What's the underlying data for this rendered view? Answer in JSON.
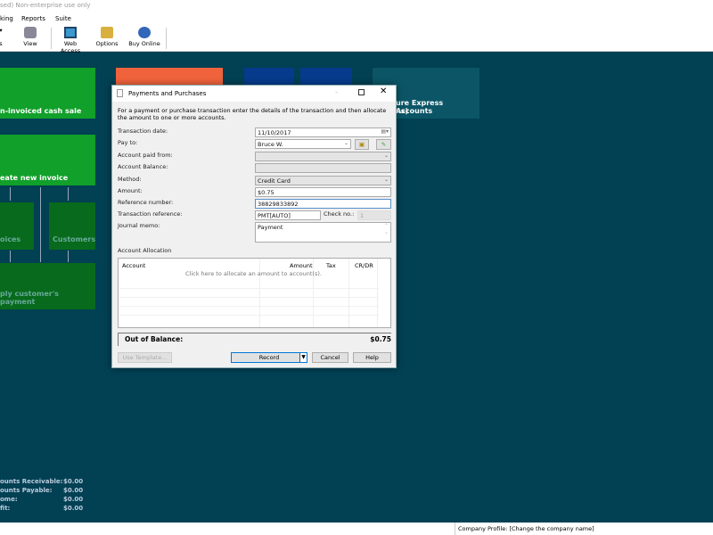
{
  "app": {
    "title": "sed) Non-enterprise use only"
  },
  "menu": [
    "king",
    "Reports",
    "Suite"
  ],
  "toolbar": [
    {
      "label": "s",
      "icon": "partial-icon"
    },
    {
      "label": "View",
      "icon": "view-icon"
    },
    {
      "label": "Web Access",
      "icon": "web-access-icon"
    },
    {
      "label": "Options",
      "icon": "options-icon"
    },
    {
      "label": "Buy Online",
      "icon": "buy-online-icon"
    }
  ],
  "tiles": {
    "cash_sale": "n-invoiced cash sale",
    "new_invoice": "eate new invoice",
    "invoices": "oices",
    "customers": "Customers",
    "apply_payment": "ply customer's payment",
    "express_accounts": "ure Express Accounts",
    "express_accounts_2": "ns)"
  },
  "colors": {
    "background": "#024053",
    "green": "#11a02a",
    "dark_green": "#086a1c",
    "orange": "#f0623c",
    "blue": "#063a8c",
    "teal": "#0b5566"
  },
  "dialog": {
    "title": "Payments and Purchases",
    "intro": "For a payment or purchase transaction enter the details of the transaction and then allocate the amount to one or more accounts.",
    "labels": {
      "date": "Transaction date:",
      "pay_to": "Pay to:",
      "paid_from": "Account paid from:",
      "balance": "Account Balance:",
      "method": "Method:",
      "amount": "Amount:",
      "ref_number": "Reference number:",
      "txn_ref": "Transaction reference:",
      "check_no": "Check no.:",
      "memo": "Journal memo:",
      "allocation": "Account Allocation"
    },
    "values": {
      "date": "11/10/2017",
      "pay_to": "Bruce W.",
      "paid_from": "",
      "balance": "",
      "method": "Credit Card",
      "amount": "$0.75",
      "ref_number": "38829833892",
      "txn_ref": "PMT[AUTO]",
      "check_no": "1",
      "memo": "Payment"
    },
    "grid": {
      "columns": [
        "Account",
        "Amount",
        "Tax",
        "CR/DR"
      ],
      "placeholder": "Click here to allocate an amount to account(s)."
    },
    "out_of_balance_label": "Out of Balance:",
    "out_of_balance_value": "$0.75",
    "buttons": {
      "template": "Use Template...",
      "record": "Record",
      "cancel": "Cancel",
      "help": "Help"
    }
  },
  "summary": [
    {
      "label": "ounts Receivable:",
      "value": "$0.00"
    },
    {
      "label": "ounts Payable:",
      "value": "$0.00"
    },
    {
      "label": "ome:",
      "value": "$0.00"
    },
    {
      "label": "fit:",
      "value": "$0.00"
    }
  ],
  "status": {
    "company": "Company Profile: [Change the company name]"
  }
}
